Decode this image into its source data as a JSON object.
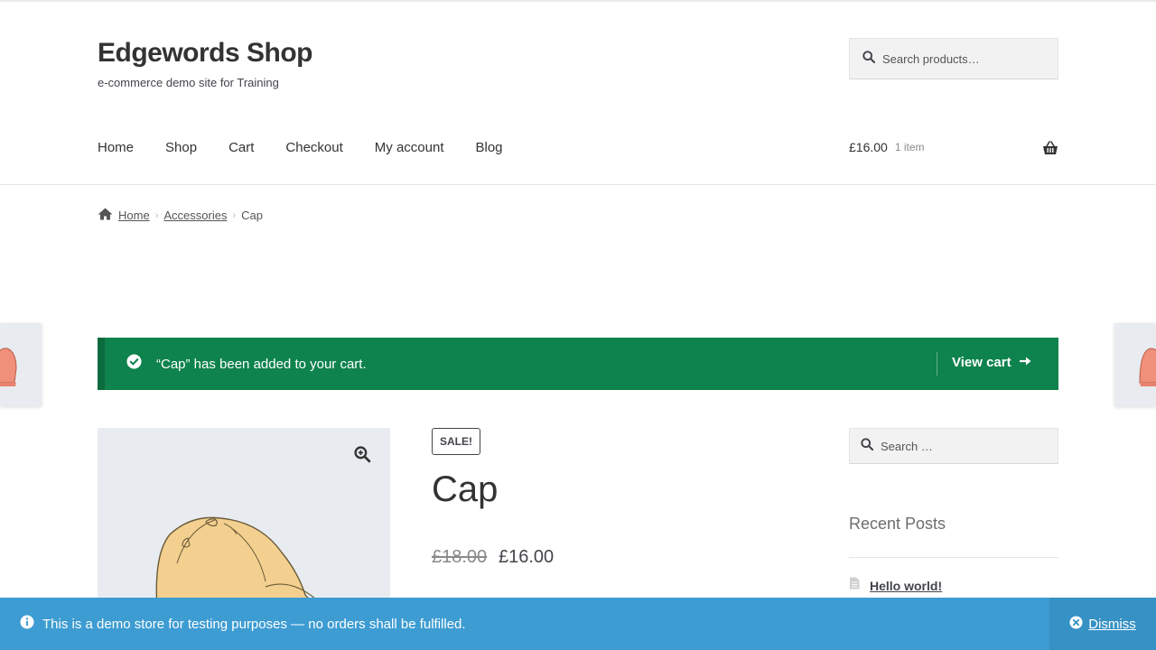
{
  "site": {
    "title": "Edgewords Shop",
    "description": "e-commerce demo site for Training"
  },
  "header_search": {
    "placeholder": "Search products…"
  },
  "nav": {
    "items": [
      "Home",
      "Shop",
      "Cart",
      "Checkout",
      "My account",
      "Blog"
    ]
  },
  "cart": {
    "amount": "£16.00",
    "count": "1 item",
    "icon": "basket-icon"
  },
  "breadcrumb": {
    "home": "Home",
    "category": "Accessories",
    "current": "Cap",
    "separator": "›"
  },
  "notice": {
    "message": "“Cap” has been added to your cart.",
    "view_cart": "View cart",
    "color": "#0f834d"
  },
  "product": {
    "badge": "SALE!",
    "title": "Cap",
    "old_price": "£18.00",
    "new_price": "£16.00"
  },
  "sidebar": {
    "search_placeholder": "Search …",
    "recent_title": "Recent Posts",
    "recent_posts": [
      "Hello world!"
    ]
  },
  "store_notice": {
    "message": "This is a demo store for testing purposes — no orders shall be fulfilled.",
    "dismiss": "Dismiss",
    "color": "#3d9cd2"
  }
}
